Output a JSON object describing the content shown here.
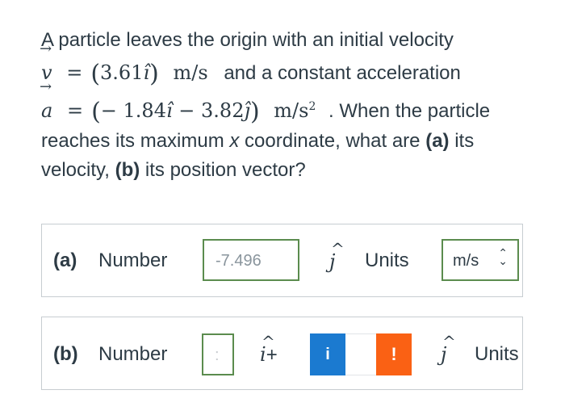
{
  "question": {
    "line1": "A particle leaves the origin with an initial velocity",
    "v_symbol": "v",
    "v_eq": "=",
    "v_value": "3.61",
    "v_unit_vec": "î",
    "v_units": "m/s",
    "line2_tail": "and a constant acceleration",
    "a_symbol": "a",
    "a_eq": "=",
    "a_value1": "− 1.84",
    "a_unit1": "î",
    "a_value2": "− 3.82",
    "a_unit2": "ĵ",
    "a_units": "m/s",
    "a_units_exp": "2",
    "line3_tail": ". When the particle",
    "line4_start": "reaches its maximum ",
    "line4_x": "x",
    "line4_mid": " coordinate, what are ",
    "line4_a": "(a)",
    "line4_end": " its",
    "line5_start": "velocity, ",
    "line5_b": "(b)",
    "line5_end": " its position vector?"
  },
  "part_a": {
    "label": "(a)",
    "number_label": "Number",
    "value": "-7.496",
    "unit_vec": "j",
    "units_label": "Units",
    "units_value": "m/s"
  },
  "part_b": {
    "label": "(b)",
    "number_label": "Number",
    "value_hint": ":",
    "unit_vec_i": "i",
    "plus": "+",
    "info_icon": "i",
    "warn_icon": "!",
    "unit_vec_j": "j",
    "units_label": "Units"
  },
  "colors": {
    "text": "#2d3b45",
    "input_border": "#5b8c4e",
    "info_button": "#1b7ad0",
    "warn_button": "#fa6114"
  }
}
